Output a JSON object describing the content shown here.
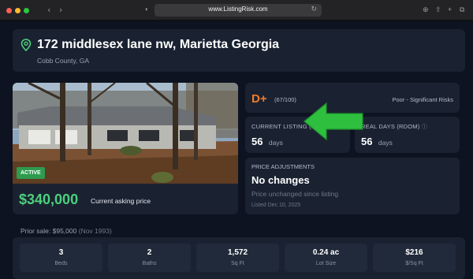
{
  "browser": {
    "url": "www.ListingRisk.com",
    "back_icon": "chevron-left-icon",
    "forward_icon": "chevron-right-icon"
  },
  "listing": {
    "address": "172 middlesex lane nw, Marietta Georgia",
    "county": "Cobb County, GA",
    "status_badge": "ACTIVE",
    "price": "$340,000",
    "price_note": "Current asking price"
  },
  "risk": {
    "grade": "D+",
    "score": "(67/100)",
    "label": "Poor - Significant Risks",
    "grade_color": "#f07c2b"
  },
  "stats": [
    {
      "label": "CURRENT LISTING (DOM)",
      "value": "56",
      "unit": "days"
    },
    {
      "label": "REAL DAYS (RDOM)",
      "value": "56",
      "unit": "days"
    }
  ],
  "price_adjustments": {
    "label": "PRICE ADJUSTMENTS",
    "headline": "No changes",
    "note": "Price unchanged since listing",
    "date": "Listed Dec 10, 2025"
  },
  "prior_sale": {
    "text": "Prior sale: $95,000",
    "year": "(Nov 1993)"
  },
  "facts": [
    {
      "value": "3",
      "label": "Beds"
    },
    {
      "value": "2",
      "label": "Baths"
    },
    {
      "value": "1,572",
      "label": "Sq Ft"
    },
    {
      "value": "0.24 ac",
      "label": "Lot Size"
    },
    {
      "value": "$216",
      "label": "$/Sq Ft"
    }
  ],
  "colors": {
    "accent_green": "#4cd07d",
    "arrow_green": "#2fbf3f",
    "card_bg": "#1a2231"
  }
}
